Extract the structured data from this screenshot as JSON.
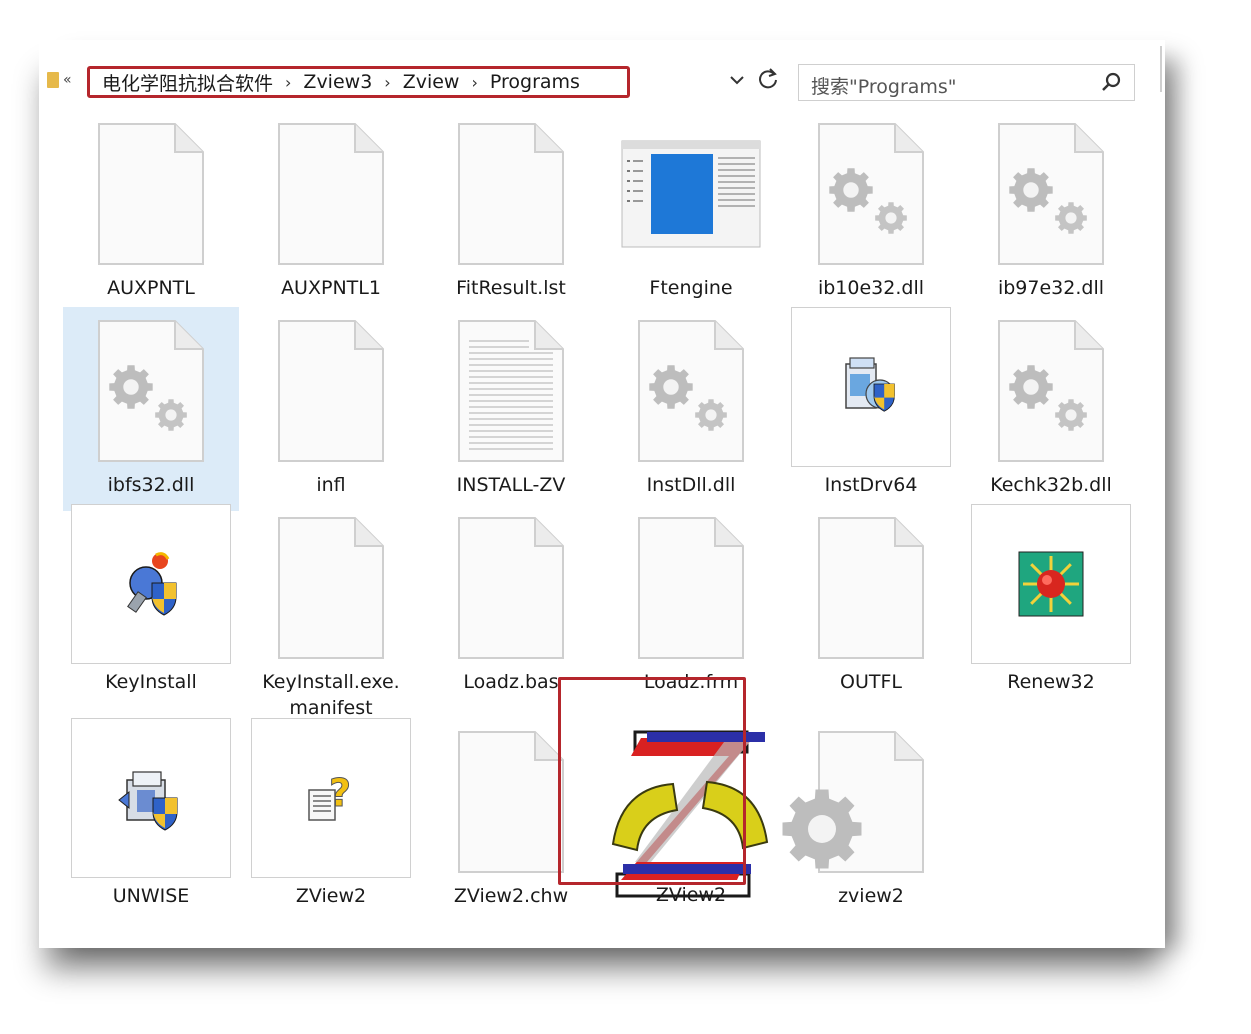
{
  "address": {
    "crumbs": [
      "电化学阻抗拟合软件",
      "Zview3",
      "Zview",
      "Programs"
    ],
    "separator": "›"
  },
  "search": {
    "placeholder": "搜索\"Programs\""
  },
  "files": [
    {
      "name": "AUXPNTL",
      "icon": "blank-file-icon"
    },
    {
      "name": "AUXPNTL1",
      "icon": "blank-file-icon"
    },
    {
      "name": "FitResult.lst",
      "icon": "blank-file-icon"
    },
    {
      "name": "Ftengine",
      "icon": "application-window-icon"
    },
    {
      "name": "ib10e32.dll",
      "icon": "gear-file-icon"
    },
    {
      "name": "ib97e32.dll",
      "icon": "gear-file-icon"
    },
    {
      "name": "ibfs32.dll",
      "icon": "gear-file-icon",
      "selected": true
    },
    {
      "name": "infl",
      "icon": "blank-file-icon"
    },
    {
      "name": "INSTALL-ZV",
      "icon": "text-file-icon"
    },
    {
      "name": "InstDll.dll",
      "icon": "gear-file-icon"
    },
    {
      "name": "InstDrv64",
      "icon": "installer-icon"
    },
    {
      "name": "Kechk32b.dll",
      "icon": "gear-file-icon"
    },
    {
      "name": "KeyInstall",
      "icon": "key-install-icon"
    },
    {
      "name": "KeyInstall.exe.\nmanifest",
      "icon": "blank-file-icon"
    },
    {
      "name": "Loadz.bas",
      "icon": "blank-file-icon"
    },
    {
      "name": "Loadz.frm",
      "icon": "blank-file-icon"
    },
    {
      "name": "OUTFL",
      "icon": "blank-file-icon"
    },
    {
      "name": "Renew32",
      "icon": "renew-icon"
    },
    {
      "name": "UNWISE",
      "icon": "uninstall-icon"
    },
    {
      "name": "ZView2",
      "icon": "help-file-icon"
    },
    {
      "name": "ZView2.chw",
      "icon": "blank-file-icon"
    },
    {
      "name": "ZView2",
      "icon": "zview-logo-icon",
      "highlighted": true
    },
    {
      "name": "zview2",
      "icon": "config-gear-file-icon"
    }
  ],
  "colors": {
    "highlight_border": "#b5262c",
    "selection": "#dcebf8"
  }
}
